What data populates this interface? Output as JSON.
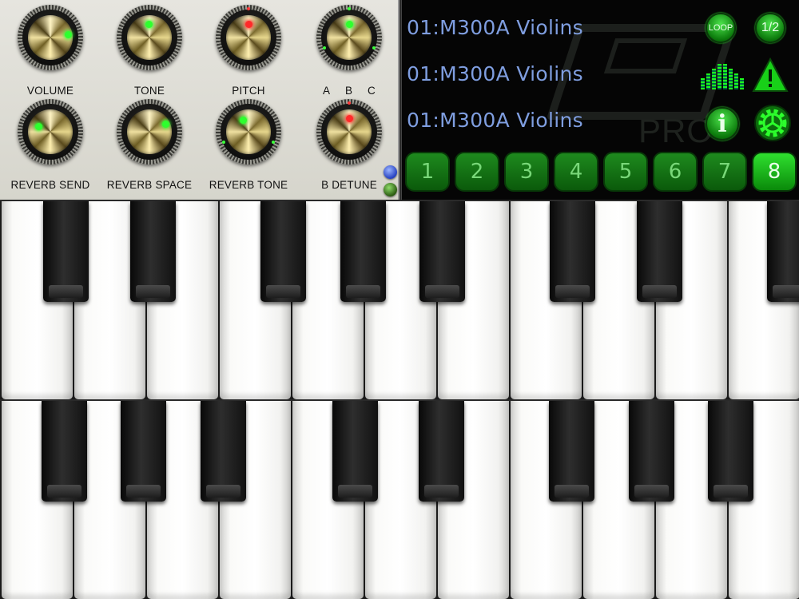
{
  "knobs": [
    {
      "name": "knob-volume",
      "label": "VOLUME",
      "indicator": "green"
    },
    {
      "name": "knob-tone",
      "label": "TONE",
      "indicator": "green"
    },
    {
      "name": "knob-pitch",
      "label": "PITCH",
      "indicator": "red"
    },
    {
      "name": "knob-abc",
      "label": "",
      "indicator": "green"
    },
    {
      "name": "knob-reverb-send",
      "label": "REVERB SEND",
      "indicator": "green"
    },
    {
      "name": "knob-reverb-space",
      "label": "REVERB SPACE",
      "indicator": "green"
    },
    {
      "name": "knob-reverb-tone",
      "label": "REVERB TONE",
      "indicator": "green"
    },
    {
      "name": "knob-b-detune",
      "label": "B DETUNE",
      "indicator": "red"
    }
  ],
  "abc_labels": [
    "A",
    "B",
    "C"
  ],
  "patch_lines": [
    "01:M300A Violins",
    "01:M300A Violins",
    "01:M300A Violins"
  ],
  "buttons": {
    "loop": "LOOP",
    "half": "1/2",
    "info": "i"
  },
  "watermark": "PRO",
  "presets": [
    "1",
    "2",
    "3",
    "4",
    "5",
    "6",
    "7",
    "8"
  ],
  "active_preset": "8",
  "icons": {
    "warning": "warning-triangle-icon",
    "settings": "gear-icon",
    "meter": "level-meter-icon"
  },
  "colors": {
    "panel": "#dddcd4",
    "display_bg": "#050505",
    "patch_text": "#7f9ee0",
    "accent_green": "#1fbf1f",
    "indicator_green": "#2eff2e",
    "indicator_red": "#ff2a2a"
  }
}
